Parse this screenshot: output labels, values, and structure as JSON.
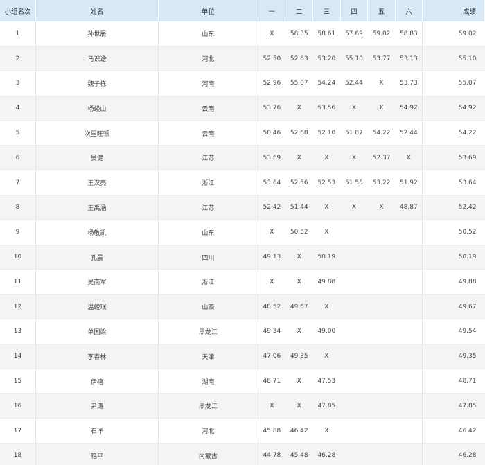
{
  "headers": {
    "rank": "小组名次",
    "name": "姓名",
    "unit": "单位",
    "t1": "一",
    "t2": "二",
    "t3": "三",
    "t4": "四",
    "t5": "五",
    "t6": "六",
    "best": "成绩"
  },
  "rows": [
    {
      "rank": "1",
      "name": "孙世辰",
      "unit": "山东",
      "t1": "X",
      "t2": "58.35",
      "t3": "58.61",
      "t4": "57.69",
      "t5": "59.02",
      "t6": "58.83",
      "best": "59.02"
    },
    {
      "rank": "2",
      "name": "马识途",
      "unit": "河北",
      "t1": "52.50",
      "t2": "52.63",
      "t3": "53.20",
      "t4": "55.10",
      "t5": "53.77",
      "t6": "53.13",
      "best": "55.10"
    },
    {
      "rank": "3",
      "name": "魏子栋",
      "unit": "河南",
      "t1": "52.96",
      "t2": "55.07",
      "t3": "54.24",
      "t4": "52.44",
      "t5": "X",
      "t6": "53.73",
      "best": "55.07"
    },
    {
      "rank": "4",
      "name": "杨峻山",
      "unit": "云南",
      "t1": "53.76",
      "t2": "X",
      "t3": "53.56",
      "t4": "X",
      "t5": "X",
      "t6": "54.92",
      "best": "54.92"
    },
    {
      "rank": "5",
      "name": "次里旺顿",
      "unit": "云南",
      "t1": "50.46",
      "t2": "52.68",
      "t3": "52.10",
      "t4": "51.87",
      "t5": "54.22",
      "t6": "52.44",
      "best": "54.22"
    },
    {
      "rank": "6",
      "name": "吴健",
      "unit": "江苏",
      "t1": "53.69",
      "t2": "X",
      "t3": "X",
      "t4": "X",
      "t5": "52.37",
      "t6": "X",
      "best": "53.69"
    },
    {
      "rank": "7",
      "name": "王汉亮",
      "unit": "浙江",
      "t1": "53.64",
      "t2": "52.56",
      "t3": "52.53",
      "t4": "51.56",
      "t5": "53.22",
      "t6": "51.92",
      "best": "53.64"
    },
    {
      "rank": "8",
      "name": "王禹涵",
      "unit": "江苏",
      "t1": "52.42",
      "t2": "51.44",
      "t3": "X",
      "t4": "X",
      "t5": "X",
      "t6": "48.87",
      "best": "52.42"
    },
    {
      "rank": "9",
      "name": "杨敬凯",
      "unit": "山东",
      "t1": "X",
      "t2": "50.52",
      "t3": "X",
      "t4": "",
      "t5": "",
      "t6": "",
      "best": "50.52"
    },
    {
      "rank": "10",
      "name": "孔晨",
      "unit": "四川",
      "t1": "49.13",
      "t2": "X",
      "t3": "50.19",
      "t4": "",
      "t5": "",
      "t6": "",
      "best": "50.19"
    },
    {
      "rank": "11",
      "name": "吴南军",
      "unit": "浙江",
      "t1": "X",
      "t2": "X",
      "t3": "49.88",
      "t4": "",
      "t5": "",
      "t6": "",
      "best": "49.88"
    },
    {
      "rank": "12",
      "name": "温峻珉",
      "unit": "山西",
      "t1": "48.52",
      "t2": "49.67",
      "t3": "X",
      "t4": "",
      "t5": "",
      "t6": "",
      "best": "49.67"
    },
    {
      "rank": "13",
      "name": "单国梁",
      "unit": "黑龙江",
      "t1": "49.54",
      "t2": "X",
      "t3": "49.00",
      "t4": "",
      "t5": "",
      "t6": "",
      "best": "49.54"
    },
    {
      "rank": "14",
      "name": "李春林",
      "unit": "天津",
      "t1": "47.06",
      "t2": "49.35",
      "t3": "X",
      "t4": "",
      "t5": "",
      "t6": "",
      "best": "49.35"
    },
    {
      "rank": "15",
      "name": "伊禧",
      "unit": "湖南",
      "t1": "48.71",
      "t2": "X",
      "t3": "47.53",
      "t4": "",
      "t5": "",
      "t6": "",
      "best": "48.71"
    },
    {
      "rank": "16",
      "name": "尹涛",
      "unit": "黑龙江",
      "t1": "X",
      "t2": "X",
      "t3": "47.85",
      "t4": "",
      "t5": "",
      "t6": "",
      "best": "47.85"
    },
    {
      "rank": "17",
      "name": "石洋",
      "unit": "河北",
      "t1": "45.88",
      "t2": "46.42",
      "t3": "X",
      "t4": "",
      "t5": "",
      "t6": "",
      "best": "46.42"
    },
    {
      "rank": "18",
      "name": "艳平",
      "unit": "内蒙古",
      "t1": "44.78",
      "t2": "45.48",
      "t3": "46.28",
      "t4": "",
      "t5": "",
      "t6": "",
      "best": "46.28"
    }
  ]
}
